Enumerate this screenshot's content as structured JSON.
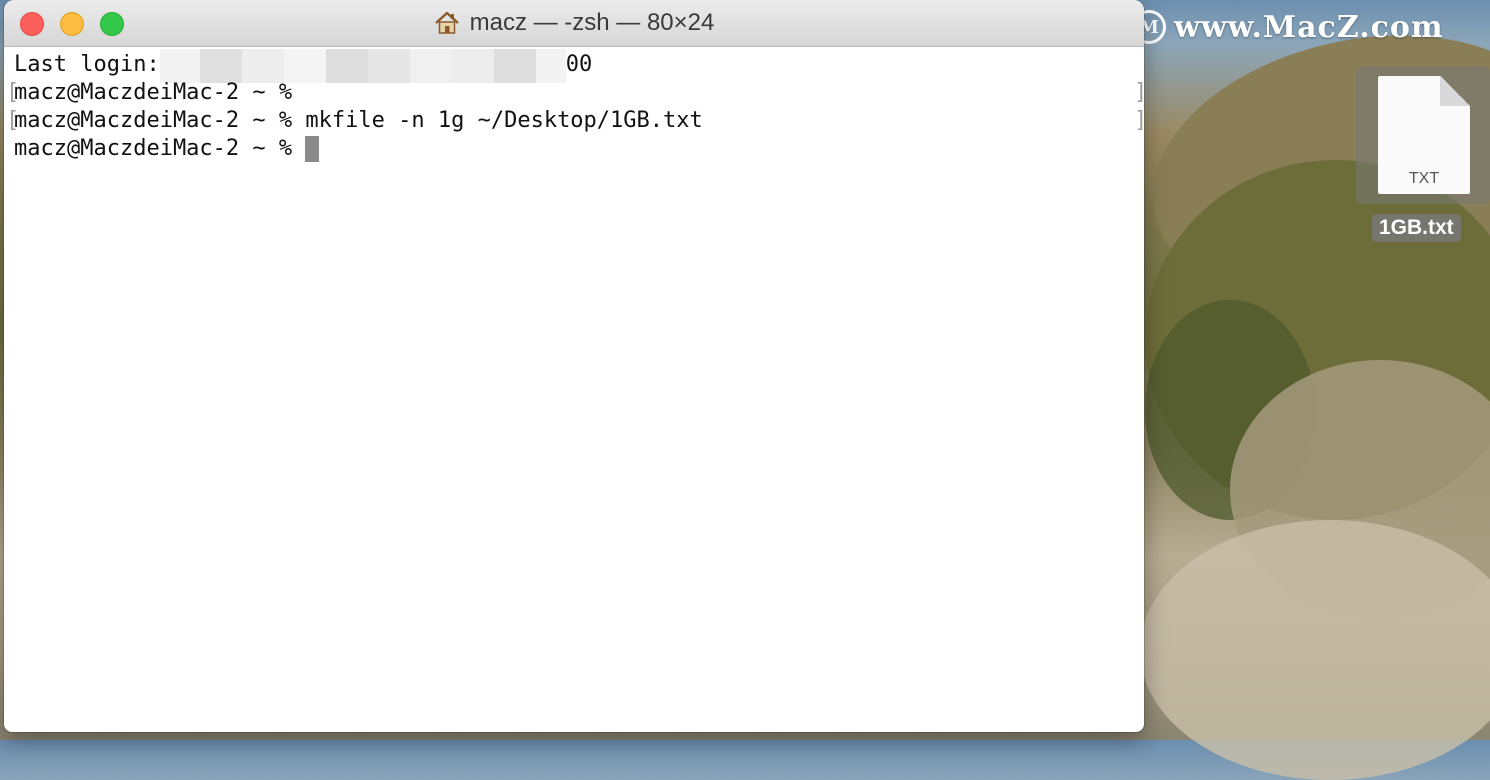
{
  "window": {
    "title": "macz — -zsh — 80×24",
    "title_icon": "home-icon"
  },
  "terminal": {
    "last_login_label": "Last login:",
    "last_login_tail": "00",
    "prompt": "macz@MaczdeiMac-2 ~ % ",
    "lines": [
      {
        "command": ""
      },
      {
        "command": "mkfile -n 1g ~/Desktop/1GB.txt"
      }
    ]
  },
  "desktop": {
    "file": {
      "name": "1GB.txt",
      "extension": "TXT",
      "icon": "text-file-icon"
    }
  },
  "watermark": {
    "text": "www.MacZ.com",
    "logo": "macz-logo"
  },
  "colors": {
    "close": "#fc605c",
    "minimize": "#fdbc40",
    "maximize": "#34c84a"
  }
}
